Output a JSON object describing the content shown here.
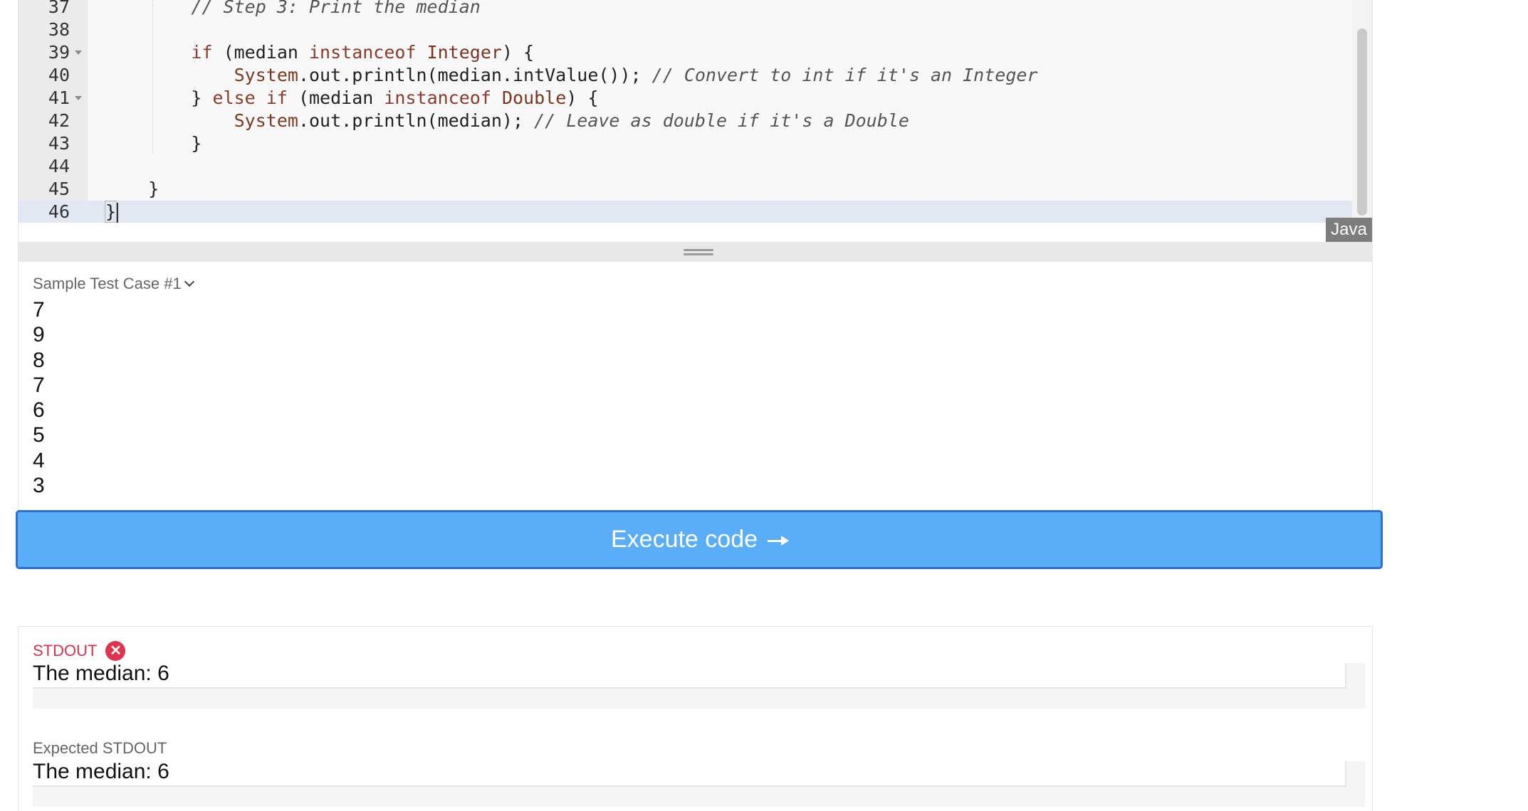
{
  "editor": {
    "language": "Java",
    "lines": [
      {
        "num": "37",
        "fold": false,
        "tokens": [
          {
            "t": "        "
          },
          {
            "t": "// Step 3: Print the median",
            "c": "cm"
          }
        ]
      },
      {
        "num": "38",
        "fold": false,
        "tokens": []
      },
      {
        "num": "39",
        "fold": true,
        "tokens": [
          {
            "t": "        "
          },
          {
            "t": "if",
            "c": "kw"
          },
          {
            "t": " (median "
          },
          {
            "t": "instanceof",
            "c": "kw"
          },
          {
            "t": " "
          },
          {
            "t": "Integer",
            "c": "cls"
          },
          {
            "t": ") {"
          }
        ]
      },
      {
        "num": "40",
        "fold": false,
        "tokens": [
          {
            "t": "            "
          },
          {
            "t": "System",
            "c": "sys"
          },
          {
            "t": ".out.println(median.intValue()); "
          },
          {
            "t": "// Convert to int if it's an Integer",
            "c": "cm"
          }
        ]
      },
      {
        "num": "41",
        "fold": true,
        "tokens": [
          {
            "t": "        } "
          },
          {
            "t": "else",
            "c": "kw"
          },
          {
            "t": " "
          },
          {
            "t": "if",
            "c": "kw"
          },
          {
            "t": " (median "
          },
          {
            "t": "instanceof",
            "c": "kw"
          },
          {
            "t": " "
          },
          {
            "t": "Double",
            "c": "cls"
          },
          {
            "t": ") {"
          }
        ]
      },
      {
        "num": "42",
        "fold": false,
        "tokens": [
          {
            "t": "            "
          },
          {
            "t": "System",
            "c": "sys"
          },
          {
            "t": ".out.println(median); "
          },
          {
            "t": "// Leave as double if it's a Double",
            "c": "cm"
          }
        ]
      },
      {
        "num": "43",
        "fold": false,
        "tokens": [
          {
            "t": "        }"
          }
        ]
      },
      {
        "num": "44",
        "fold": false,
        "tokens": []
      },
      {
        "num": "45",
        "fold": false,
        "tokens": [
          {
            "t": "    }"
          }
        ]
      },
      {
        "num": "46",
        "fold": false,
        "active": true,
        "tokens": [
          {
            "t": "}",
            "c": "bracket"
          }
        ]
      }
    ]
  },
  "test_case": {
    "title": "Sample Test Case #1",
    "values": [
      "7",
      "9",
      "8",
      "7",
      "6",
      "5",
      "4",
      "3"
    ]
  },
  "execute_button": {
    "label": "Execute code"
  },
  "output": {
    "stdout_label": "STDOUT",
    "stdout_status": "error",
    "stdout_value": "The median: 6",
    "expected_label": "Expected STDOUT",
    "expected_value": "The median: 6"
  },
  "colors": {
    "accent": "#5aaef7",
    "accent_border": "#2f6fd2",
    "error": "#e0334f"
  }
}
